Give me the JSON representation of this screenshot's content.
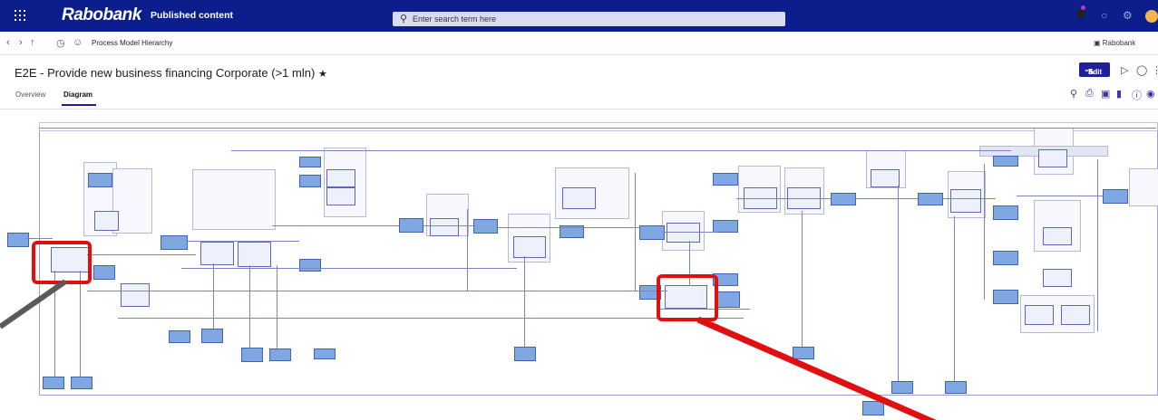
{
  "topbar": {
    "brand": "Rabobank",
    "section": "Published content",
    "search_placeholder": "Enter search term here",
    "search_icon": "search-icon",
    "apps_icon": "waffle-icon"
  },
  "breadcrumb": {
    "back_icon": "chevron-left-icon",
    "forward_icon": "chevron-right-icon",
    "up_icon": "arrow-up-icon",
    "history_icon": "clock-icon",
    "user_icon": "user-icon",
    "current": "Process Model Hierarchy",
    "org": "Rabobank"
  },
  "header": {
    "title": "E2E - Provide new business financing Corporate (>1 mln)",
    "star": "★",
    "edit_label": "Edit"
  },
  "tabs": [
    {
      "label": "Overview"
    },
    {
      "label": "Diagram"
    }
  ],
  "colors": {
    "topbar": "#0b1e8c",
    "accent": "#1f1f99",
    "highlight": "#e01010"
  }
}
